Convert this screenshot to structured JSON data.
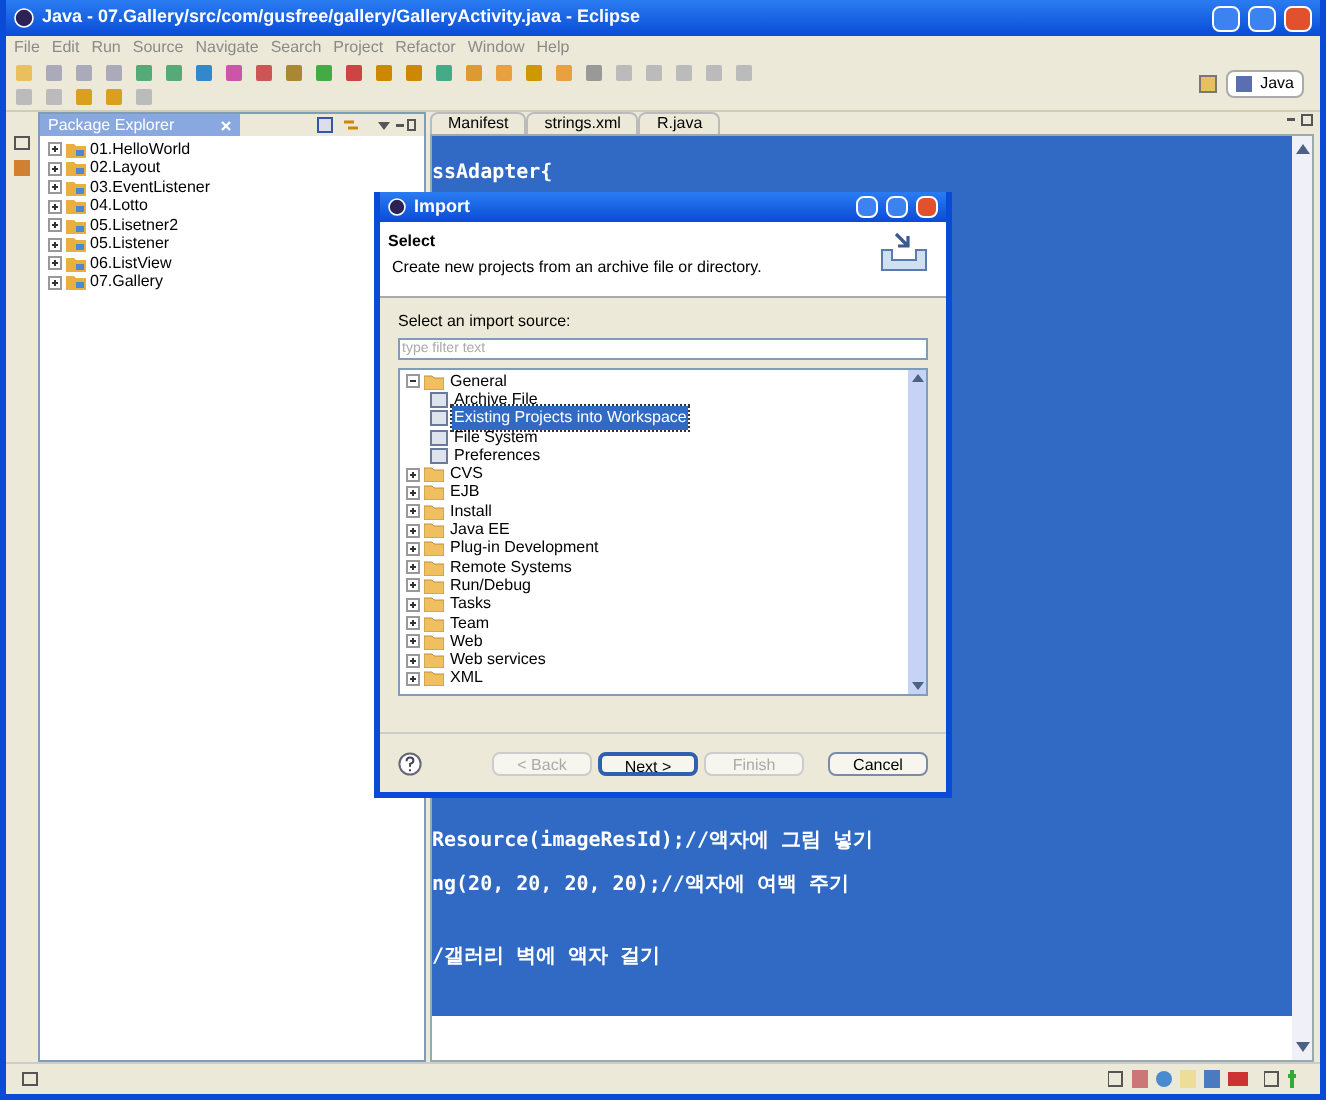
{
  "window": {
    "title": "Java - 07.Gallery/src/com/gusfree/gallery/GalleryActivity.java - Eclipse"
  },
  "menu": [
    "File",
    "Edit",
    "Run",
    "Source",
    "Navigate",
    "Search",
    "Project",
    "Refactor",
    "Window",
    "Help"
  ],
  "perspective": {
    "label": "Java"
  },
  "package_explorer": {
    "title": "Package Explorer",
    "projects": [
      "01.HelloWorld",
      "02.Layout",
      "03.EventListener",
      "04.Lotto",
      "05.Lisetner2",
      "05.Listener",
      "06.ListView",
      "07.Gallery"
    ]
  },
  "editor": {
    "tabs": [
      {
        "label": "Manifest",
        "selected": false
      },
      {
        "label": "strings.xml",
        "selected": false
      },
      {
        "label": "R.java",
        "selected": false
      }
    ],
    "lines": [
      {
        "text": "ssAdapter{"
      },
      {
        "text": "Resource(imageResId);//액자에 그림 넣기"
      },
      {
        "text": "ng(20, 20, 20, 20);//액자에 여백 주기"
      },
      {
        "text": "/갤러리 벽에 액자 걸기"
      }
    ]
  },
  "dialog": {
    "title": "Import",
    "heading": "Select",
    "description": "Create new projects from an archive file or directory.",
    "source_label": "Select an import source:",
    "filter": {
      "placeholder": "type filter text"
    },
    "tree": [
      {
        "label": "General",
        "expanded": true,
        "selected": false,
        "children": [
          {
            "label": "Archive File",
            "selected": false
          },
          {
            "label": "Existing Projects into Workspace",
            "selected": true
          },
          {
            "label": "File System",
            "selected": false
          },
          {
            "label": "Preferences",
            "selected": false
          }
        ]
      },
      {
        "label": "CVS",
        "expanded": false,
        "selected": false
      },
      {
        "label": "EJB",
        "expanded": false,
        "selected": false
      },
      {
        "label": "Install",
        "expanded": false,
        "selected": false
      },
      {
        "label": "Java EE",
        "expanded": false,
        "selected": false
      },
      {
        "label": "Plug-in Development",
        "expanded": false,
        "selected": false
      },
      {
        "label": "Remote Systems",
        "expanded": false,
        "selected": false
      },
      {
        "label": "Run/Debug",
        "expanded": false,
        "selected": false
      },
      {
        "label": "Tasks",
        "expanded": false,
        "selected": false
      },
      {
        "label": "Team",
        "expanded": false,
        "selected": false
      },
      {
        "label": "Web",
        "expanded": false,
        "selected": false
      },
      {
        "label": "Web services",
        "expanded": false,
        "selected": false
      },
      {
        "label": "XML",
        "expanded": false,
        "selected": false
      }
    ],
    "buttons": [
      {
        "label": "< Back",
        "disabled": true,
        "default": false
      },
      {
        "label": "Next >",
        "disabled": false,
        "default": true
      },
      {
        "label": "Finish",
        "disabled": true,
        "default": false
      },
      {
        "label": "Cancel",
        "disabled": false,
        "default": false
      }
    ]
  }
}
